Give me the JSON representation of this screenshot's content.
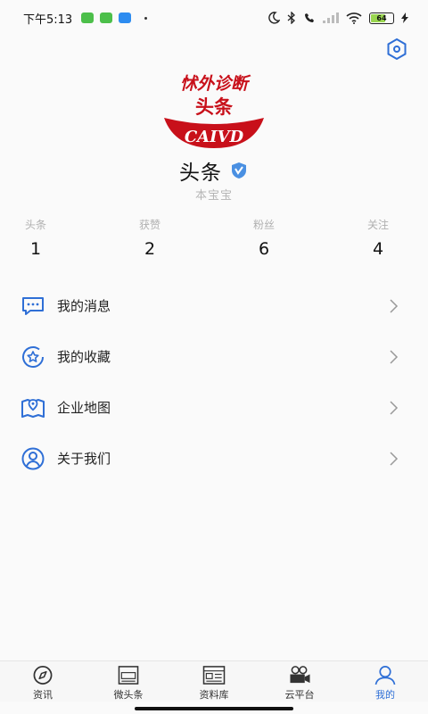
{
  "status_bar": {
    "time": "下午5:13",
    "battery": "64"
  },
  "profile": {
    "logo_text_top": "怵外诊断",
    "logo_text_mid": "头条",
    "logo_text_band": "CAIVD",
    "name": "头条",
    "subtitle": "本宝宝"
  },
  "stats": [
    {
      "label": "头条",
      "value": "1"
    },
    {
      "label": "获赞",
      "value": "2"
    },
    {
      "label": "粉丝",
      "value": "6"
    },
    {
      "label": "关注",
      "value": "4"
    }
  ],
  "menu": [
    {
      "label": "我的消息",
      "icon": "message-icon"
    },
    {
      "label": "我的收藏",
      "icon": "favorite-icon"
    },
    {
      "label": "企业地图",
      "icon": "map-icon"
    },
    {
      "label": "关于我们",
      "icon": "about-icon"
    }
  ],
  "tabbar": [
    {
      "label": "资讯",
      "icon": "compass-icon"
    },
    {
      "label": "微头条",
      "icon": "micro-headline-icon"
    },
    {
      "label": "资料库",
      "icon": "news-library-icon"
    },
    {
      "label": "云平台",
      "icon": "camera-icon"
    },
    {
      "label": "我的",
      "icon": "profile-icon"
    }
  ],
  "colors": {
    "accent": "#2f6fd6",
    "logo_red": "#c8101a"
  }
}
